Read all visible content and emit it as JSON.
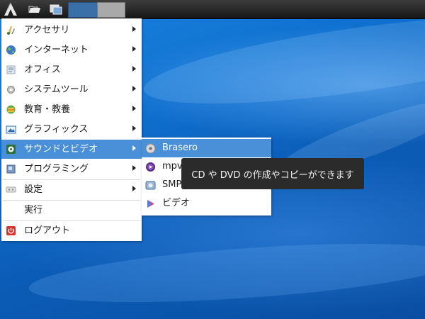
{
  "desktop": {
    "background": "#0f6fce"
  },
  "panel": {
    "launchers": [
      "start-menu-icon",
      "file-manager-icon",
      "show-desktop-icon"
    ],
    "workspaces": [
      {
        "state": "active",
        "color": "#3b6fa8"
      },
      {
        "state": "inactive",
        "color": "#a9a9a9"
      }
    ]
  },
  "menu": {
    "items": [
      {
        "label": "アクセサリ",
        "icon": "accessories-icon",
        "has_submenu": true
      },
      {
        "label": "インターネット",
        "icon": "internet-globe-icon",
        "has_submenu": true
      },
      {
        "label": "オフィス",
        "icon": "office-icon",
        "has_submenu": true
      },
      {
        "label": "システムツール",
        "icon": "system-tools-icon",
        "has_submenu": true
      },
      {
        "label": "教育・教養",
        "icon": "education-icon",
        "has_submenu": true
      },
      {
        "label": "グラフィックス",
        "icon": "graphics-icon",
        "has_submenu": true
      },
      {
        "label": "サウンドとビデオ",
        "icon": "sound-video-icon",
        "has_submenu": true,
        "active": true
      },
      {
        "label": "プログラミング",
        "icon": "programming-icon",
        "has_submenu": true
      },
      {
        "label": "設定",
        "icon": "settings-icon",
        "has_submenu": true
      },
      {
        "label": "実行",
        "icon": "",
        "has_submenu": false
      },
      {
        "label": "ログアウト",
        "icon": "logout-icon",
        "has_submenu": false
      }
    ]
  },
  "submenu": {
    "items": [
      {
        "label": "Brasero",
        "icon": "brasero-disc-icon",
        "active": true
      },
      {
        "label": "mpv",
        "icon": "mpv-player-icon"
      },
      {
        "label": "SMPlayer",
        "icon": "smplayer-icon"
      },
      {
        "label": "ビデオ",
        "icon": "video-play-icon"
      }
    ]
  },
  "tooltip": {
    "text": "CD や DVD の作成やコピーができます"
  },
  "colors": {
    "highlight": "#4a90d9",
    "tooltip_bg": "#2b2b2b",
    "menu_bg": "#ffffff"
  }
}
